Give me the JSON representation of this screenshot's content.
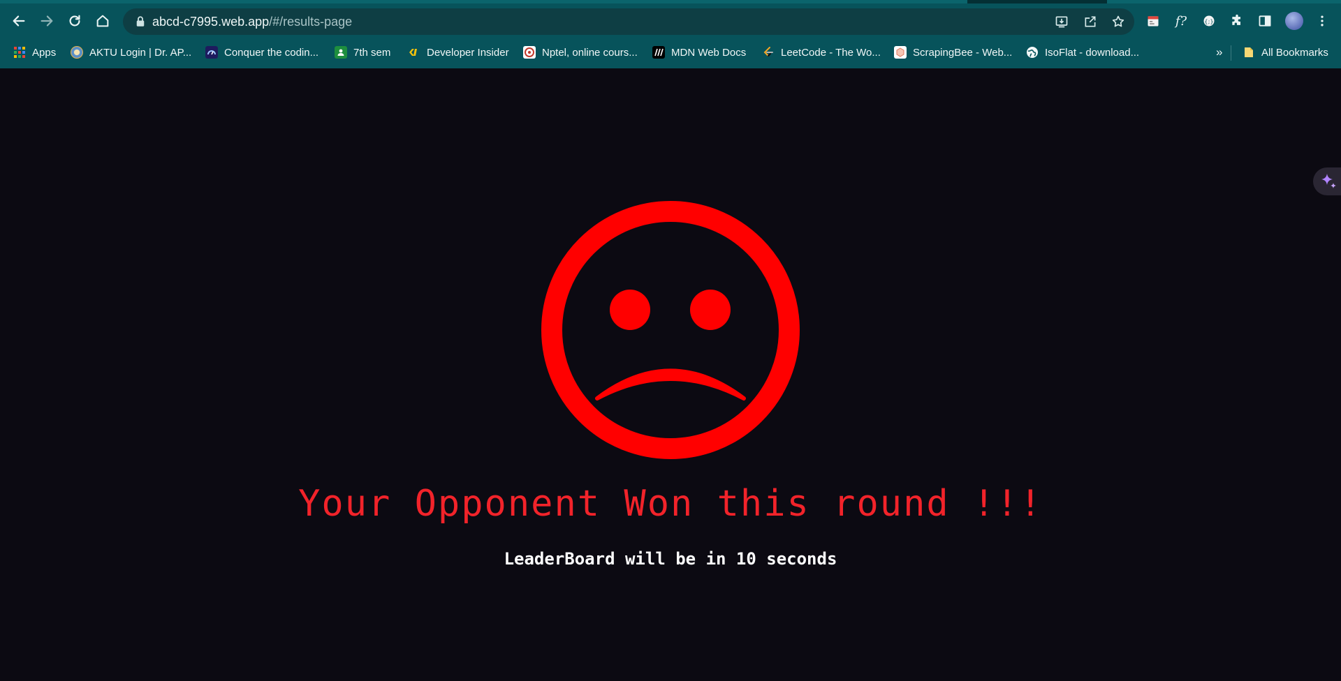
{
  "browser": {
    "url_host": "abcd-c7995.web.app",
    "url_path": "/#/results-page",
    "bookmarks": [
      {
        "label": "Apps",
        "icon": "apps-grid-icon"
      },
      {
        "label": "AKTU Login | Dr. AP...",
        "icon": "aktu-favicon"
      },
      {
        "label": "Conquer the codin...",
        "icon": "codin-favicon"
      },
      {
        "label": "7th sem",
        "icon": "classroom-favicon"
      },
      {
        "label": "Developer Insider",
        "icon": "developer-insider-favicon"
      },
      {
        "label": "Nptel, online cours...",
        "icon": "nptel-favicon"
      },
      {
        "label": "MDN Web Docs",
        "icon": "mdn-favicon"
      },
      {
        "label": "LeetCode - The Wo...",
        "icon": "leetcode-favicon"
      },
      {
        "label": "ScrapingBee - Web...",
        "icon": "scrapingbee-favicon"
      },
      {
        "label": "IsoFlat - download...",
        "icon": "globe-icon"
      }
    ],
    "overflow_label": "»",
    "all_bookmarks_label": "All Bookmarks",
    "colors": {
      "toolbar": "#07535b",
      "omnibox": "#0e3e44"
    }
  },
  "result": {
    "face_icon": "sad-face-icon",
    "headline": "Your Opponent Won this round !!!",
    "subline": "LeaderBoard will be in 10 seconds",
    "colors": {
      "background": "#0c0a12",
      "accent": "#ff0000",
      "headline": "#f2232a",
      "subline": "#ffffff"
    }
  }
}
